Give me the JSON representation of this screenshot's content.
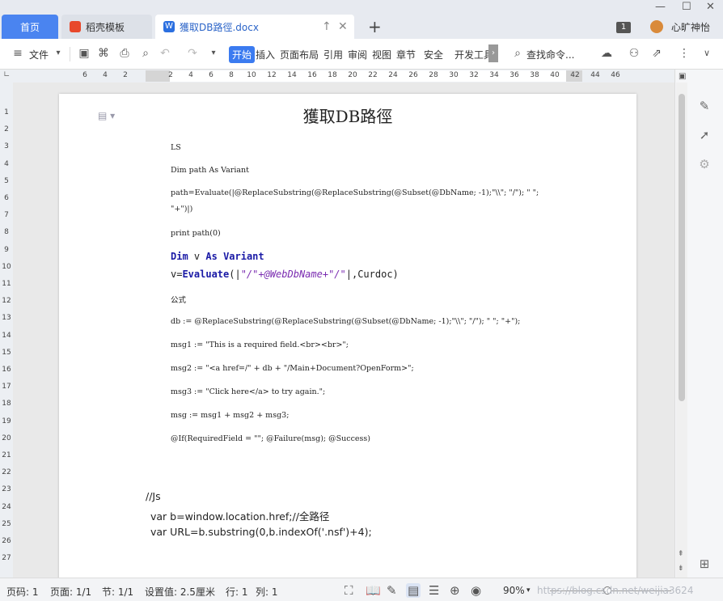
{
  "titlebar": {
    "tabs": [
      {
        "label": "首页"
      },
      {
        "label": "稻壳模板"
      },
      {
        "label": "獲取DB路徑.docx"
      }
    ],
    "badge": "1",
    "user_name": "心旷神怡"
  },
  "menu": {
    "file": "文件",
    "tabs": [
      "开始",
      "插入",
      "页面布局",
      "引用",
      "审阅",
      "视图",
      "章节",
      "安全",
      "开发工具"
    ],
    "search": "查找命令..."
  },
  "ruler": {
    "h_numbers": [
      "6",
      "4",
      "2",
      "2",
      "4",
      "6",
      "8",
      "10",
      "12",
      "14",
      "16",
      "18",
      "20",
      "22",
      "24",
      "26",
      "28",
      "30",
      "32",
      "34",
      "36",
      "38",
      "40",
      "42",
      "44",
      "46"
    ],
    "v_numbers": [
      "1",
      "2",
      "3",
      "4",
      "5",
      "6",
      "7",
      "8",
      "9",
      "10",
      "11",
      "12",
      "13",
      "14",
      "15",
      "16",
      "17",
      "18",
      "19",
      "20",
      "21",
      "22",
      "23",
      "24",
      "25",
      "26",
      "27"
    ]
  },
  "document": {
    "title": "獲取DB路徑",
    "lines": [
      "LS",
      "Dim path As Variant",
      "path=Evaluate(|@ReplaceSubstring(@ReplaceSubstring(@Subset(@DbName; -1);\"\\\\\"; \"/\"); \" \";",
      "\"+\")|)",
      "print path(0)",
      "公式",
      "db := @ReplaceSubstring(@ReplaceSubstring(@Subset(@DbName; -1);\"\\\\\"; \"/\"); \" \"; \"+\");",
      "msg1 := \"This is a required field.<br><br>\";",
      "msg2 := \"<a href=/\" + db + \"/Main+Document?OpenForm>\";",
      "msg3 := \"Click here</a> to try again.\";",
      "msg := msg1 + msg2 + msg3;",
      "@If(RequiredField = \"\"; @Failure(msg); @Success)",
      "//Js",
      "var b=window.location.href;//全路径",
      "var URL=b.substring(0,b.indexOf('.nsf')+4);"
    ],
    "code": {
      "dim_kw": "Dim",
      "dim_var": " v ",
      "as_kw": "As",
      "variant_kw": "Variant",
      "eval_prefix": "v=",
      "eval_kw": "Evaluate",
      "eval_open": "(|",
      "eval_str": "\"/\"+@WebDbName+\"/\"",
      "eval_close": "|,Curdoc)"
    }
  },
  "statusbar": {
    "page_num": "页码: 1",
    "page": "页面: 1/1",
    "section": "节: 1/1",
    "setting": "设置值: 2.5厘米",
    "row": "行: 1",
    "col": "列: 1",
    "zoom": "90%",
    "watermark": "https://blog.csdn.net/weijia3624"
  }
}
